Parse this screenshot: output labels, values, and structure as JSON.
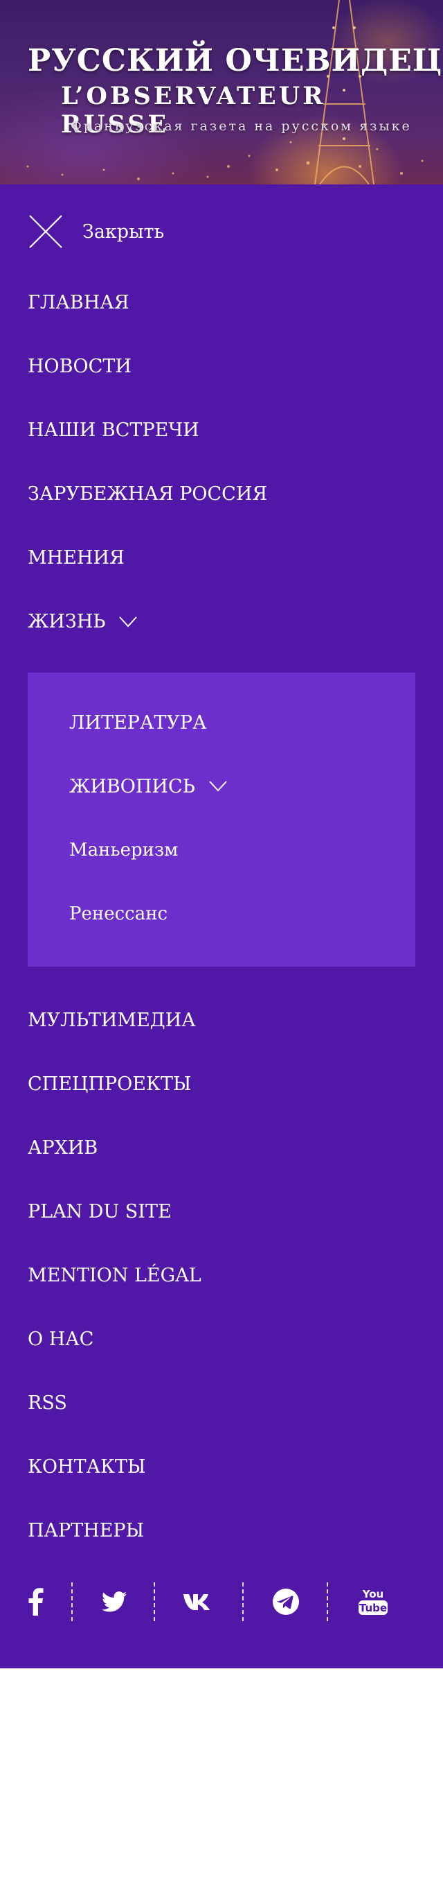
{
  "header": {
    "title_ru": "РУССКИЙ ОЧЕВИДЕЦ",
    "title_fr": "L’OBSERVATEUR RUSSE",
    "tagline": "Французская газета на русском языке"
  },
  "menu": {
    "close_label": "Закрыть",
    "items_top": [
      {
        "label": "ГЛАВНАЯ"
      },
      {
        "label": "НОВОСТИ"
      },
      {
        "label": "НАШИ ВСТРЕЧИ"
      },
      {
        "label": "ЗАРУБЕЖНАЯ РОССИЯ"
      },
      {
        "label": "МНЕНИЯ"
      },
      {
        "label": "ЖИЗНЬ",
        "expanded": true
      }
    ],
    "submenu": [
      {
        "label": "ЛИТЕРАТУРА"
      },
      {
        "label": "ЖИВОПИСЬ",
        "expanded": true
      },
      {
        "label": "Маньеризм"
      },
      {
        "label": "Ренессанс"
      }
    ],
    "items_bottom": [
      {
        "label": "МУЛЬТИМЕДИА"
      },
      {
        "label": "СПЕЦПРОЕКТЫ"
      },
      {
        "label": "АРХИВ"
      },
      {
        "label": "PLAN DU SITE"
      },
      {
        "label": "MENTION LÉGAL"
      },
      {
        "label": "О НАС"
      },
      {
        "label": "RSS"
      },
      {
        "label": "КОНТАКТЫ"
      },
      {
        "label": "ПАРТНЕРЫ"
      }
    ]
  },
  "social": {
    "icons": [
      "facebook-icon",
      "twitter-icon",
      "vk-icon",
      "telegram-icon",
      "youtube-icon"
    ],
    "youtube_text_top": "You",
    "youtube_text_bottom": "Tube"
  },
  "colors": {
    "menu_background": "#5117a6",
    "submenu_background": "#6c2fcb",
    "text": "#ffffff"
  }
}
